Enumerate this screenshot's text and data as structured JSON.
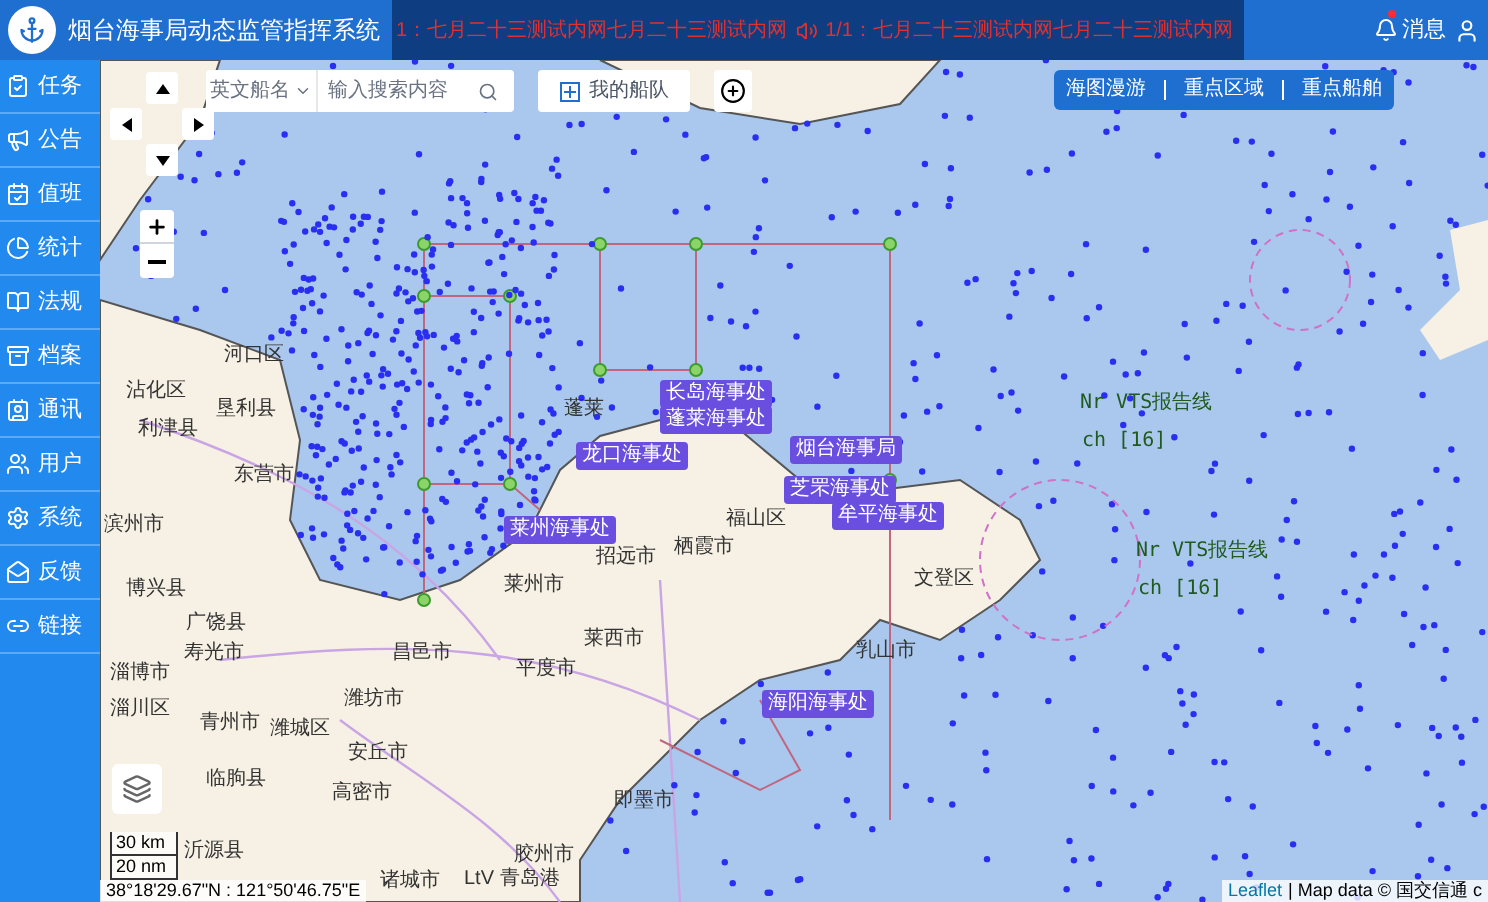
{
  "header": {
    "title": "烟台海事局动态监管指挥系统",
    "notices": [
      "1：七月二十三测试内网七月二十三测试内网",
      "1/1：七月二十三测试内网七月二十三测试内网"
    ],
    "messages_label": "消息"
  },
  "sidebar": {
    "items": [
      {
        "label": "任务",
        "kind": "task"
      },
      {
        "label": "公告",
        "kind": "notice"
      },
      {
        "label": "值班",
        "kind": "duty"
      },
      {
        "label": "统计",
        "kind": "stats"
      },
      {
        "label": "法规",
        "kind": "law"
      },
      {
        "label": "档案",
        "kind": "archive"
      },
      {
        "label": "通讯",
        "kind": "contact"
      },
      {
        "label": "用户",
        "kind": "users"
      },
      {
        "label": "系统",
        "kind": "system"
      },
      {
        "label": "反馈",
        "kind": "feedback"
      },
      {
        "label": "链接",
        "kind": "link"
      }
    ]
  },
  "search": {
    "type_value": "英文船名",
    "placeholder": "输入搜索内容"
  },
  "fleet_button": "我的船队",
  "view_tabs": [
    "海图漫游",
    "重点区域",
    "重点船舶"
  ],
  "offices": [
    "长岛海事处",
    "蓬莱海事处",
    "龙口海事处",
    "莱州海事处",
    "烟台海事局",
    "芝罘海事处",
    "牟平海事处",
    "海阳海事处"
  ],
  "places": [
    "河口区",
    "沾化区",
    "垦利县",
    "利津县",
    "东营市",
    "滨州市",
    "博兴县",
    "广饶县",
    "淄博市",
    "寿光市",
    "昌邑市",
    "潍坊市",
    "平度市",
    "莱西市",
    "莱州市",
    "招远市",
    "栖霞市",
    "福山区",
    "文登区",
    "乳山市",
    "即墨市",
    "高密市",
    "胶州市",
    "安丘市",
    "青州市",
    "潍城区",
    "临朐县",
    "诸城市",
    "沂源县",
    "淄川区",
    "LtV 青岛港",
    "蓬莱"
  ],
  "vts_labels": [
    "Nr VTS报告线",
    "ch [16]",
    "Nr VTS报告线",
    "ch [16]"
  ],
  "scale": [
    "30 km",
    "20 nm"
  ],
  "coordinates": "38°18'29.67\"N : 121°50'46.75\"E",
  "attribution": {
    "link": "Leaflet",
    "text": "| Map data © 国交信通 c"
  }
}
